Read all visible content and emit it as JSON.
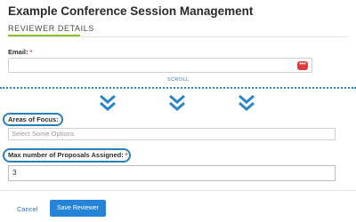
{
  "header": {
    "title": "Example Conference Session Management"
  },
  "section": {
    "title": "REVIEWER DETAILS",
    "underline_color": "#8fbf2a"
  },
  "email": {
    "label": "Email:",
    "required_mark": "*",
    "value": "",
    "icon": "warning-icon",
    "icon_glyph": "•••"
  },
  "scroll": {
    "label": "SCROLL",
    "indicator_icon": "chevron-down-icon",
    "color": "#2a86c9"
  },
  "focus": {
    "label": "Areas of Focus:",
    "placeholder": "Select Some Options"
  },
  "proposals": {
    "label": "Max number of Proposals Assigned:",
    "required_mark": "*",
    "value": "3"
  },
  "footer": {
    "cancel_label": "Cancel",
    "save_label": "Save Reviewer",
    "accent": "#2584d8"
  }
}
